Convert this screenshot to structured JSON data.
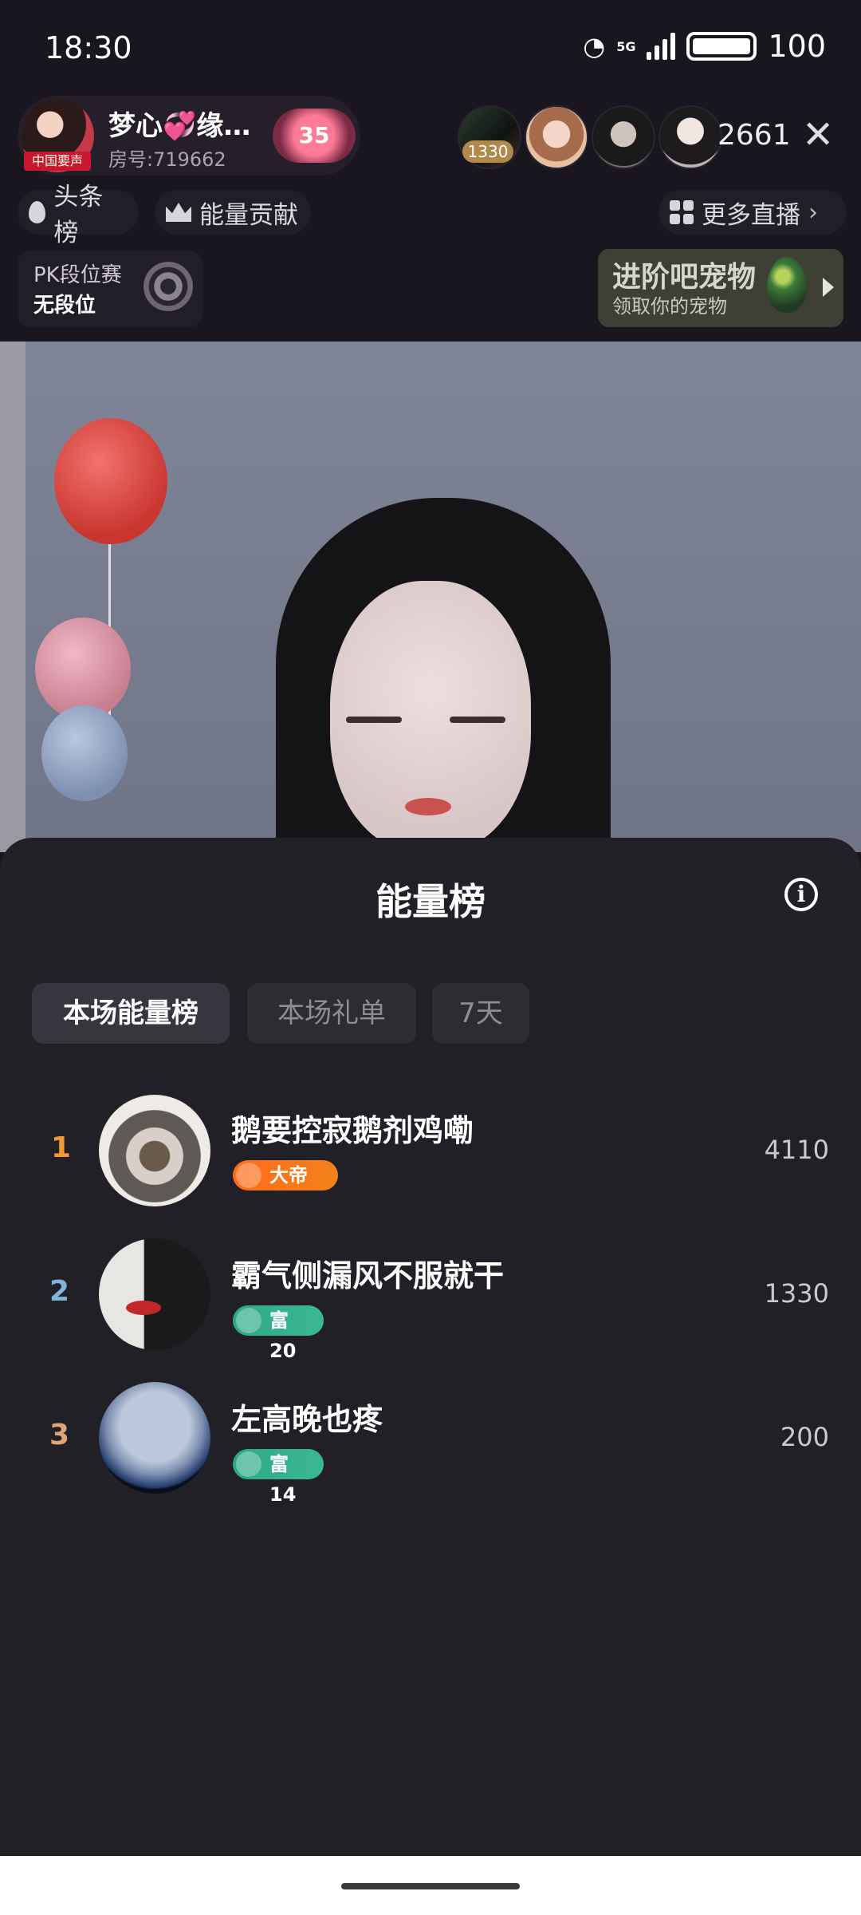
{
  "status_bar": {
    "time": "18:30",
    "network": "5G",
    "battery": "100"
  },
  "header": {
    "host_name": "梦心💞缘…",
    "room_id": "房号:719662",
    "host_avatar_tag": "中国要声",
    "heart_level": "35",
    "viewer_badge": "1330",
    "viewer_count": "2661",
    "close_label": "✕"
  },
  "chips": {
    "headline": "头条榜",
    "energy_contribution": "能量贡献",
    "more_live": "更多直播"
  },
  "pk": {
    "title": "PK段位赛",
    "subtitle": "无段位"
  },
  "pet": {
    "title": "进阶吧宠物",
    "subtitle": "领取你的宠物"
  },
  "sheet": {
    "title": "能量榜",
    "info_label": "i",
    "tabs": [
      {
        "label": "本场能量榜",
        "active": true
      },
      {
        "label": "本场礼单",
        "active": false
      },
      {
        "label": "7天",
        "active": false
      }
    ],
    "ranking": [
      {
        "rank": "1",
        "rank_color": "#f29a36",
        "name": "鹅要控寂鹅剂鸡嘞",
        "badge": "大帝",
        "badge_icon": "emperor-crest-icon",
        "score": "4110"
      },
      {
        "rank": "2",
        "rank_color": "#7fb4d6",
        "name": "霸气侧漏风不服就干",
        "badge": "富20",
        "badge_icon": "rich-triangle-icon",
        "score": "1330"
      },
      {
        "rank": "3",
        "rank_color": "#e0a476",
        "name": "左高晚也疼",
        "badge": "富14",
        "badge_icon": "rich-triangle-icon",
        "score": "200"
      }
    ]
  },
  "colors": {
    "accent_emperor": "#ff6b1a",
    "accent_rich": "#2ea886",
    "background": "#19161f",
    "sheet": "#202026"
  }
}
